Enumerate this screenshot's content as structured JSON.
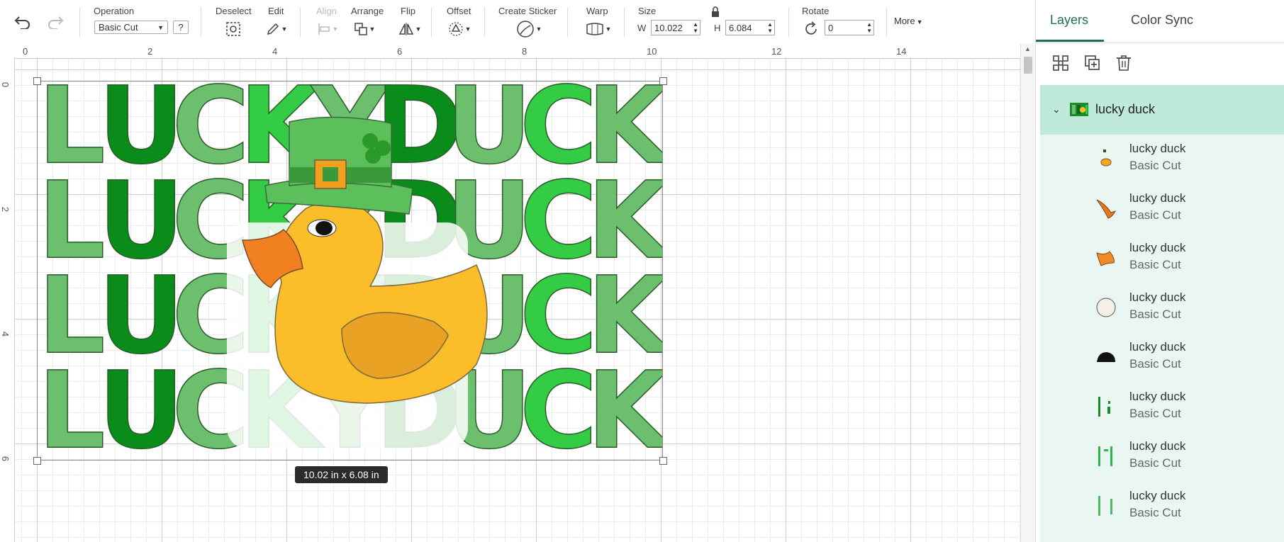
{
  "toolbar": {
    "operation_label": "Operation",
    "operation_value": "Basic Cut",
    "help_label": "?",
    "deselect_label": "Deselect",
    "edit_label": "Edit",
    "align_label": "Align",
    "arrange_label": "Arrange",
    "flip_label": "Flip",
    "offset_label": "Offset",
    "create_sticker_label": "Create Sticker",
    "warp_label": "Warp",
    "size_label": "Size",
    "width_prefix": "W",
    "width_value": "10.022",
    "height_prefix": "H",
    "height_value": "6.084",
    "rotate_label": "Rotate",
    "rotate_value": "0",
    "more_label": "More"
  },
  "canvas": {
    "ruler_h": [
      "0",
      "2",
      "4",
      "6",
      "8",
      "10",
      "12",
      "14"
    ],
    "ruler_v": [
      "0",
      "2",
      "4",
      "6"
    ],
    "size_tooltip": "10.02  in x 6.08  in"
  },
  "panel": {
    "tabs": [
      {
        "label": "Layers",
        "active": true
      },
      {
        "label": "Color Sync",
        "active": false
      }
    ],
    "group": {
      "name": "lucky duck"
    },
    "layers": [
      {
        "name": "lucky duck",
        "operation": "Basic Cut",
        "icon": "duck-eye-orange-icon",
        "color": "#f5a623"
      },
      {
        "name": "lucky duck",
        "operation": "Basic Cut",
        "icon": "beak-piece-icon",
        "color": "#e8781e"
      },
      {
        "name": "lucky duck",
        "operation": "Basic Cut",
        "icon": "beak-icon",
        "color": "#f08a24"
      },
      {
        "name": "lucky duck",
        "operation": "Basic Cut",
        "icon": "circle-shape-icon",
        "color": "#f5efe6"
      },
      {
        "name": "lucky duck",
        "operation": "Basic Cut",
        "icon": "black-dome-icon",
        "color": "#111111"
      },
      {
        "name": "lucky duck",
        "operation": "Basic Cut",
        "icon": "green-letters-icon",
        "color": "#1a8a2a"
      },
      {
        "name": "lucky duck",
        "operation": "Basic Cut",
        "icon": "green-letters-icon",
        "color": "#2fb84a"
      },
      {
        "name": "lucky duck",
        "operation": "Basic Cut",
        "icon": "green-letters-icon",
        "color": "#55b560"
      }
    ]
  },
  "design": {
    "letters": [
      "L",
      "U",
      "C",
      "K",
      "Y",
      "D",
      "U",
      "C",
      "K"
    ],
    "colors": {
      "dark": "#0a8c1a",
      "mid": "#33cc44",
      "light": "#6cbf6c",
      "duck": "#fbbd2a",
      "wing": "#eaa224",
      "beak": "#f08020",
      "hat": "#5cbf5c",
      "buckle": "#f0a020"
    }
  }
}
